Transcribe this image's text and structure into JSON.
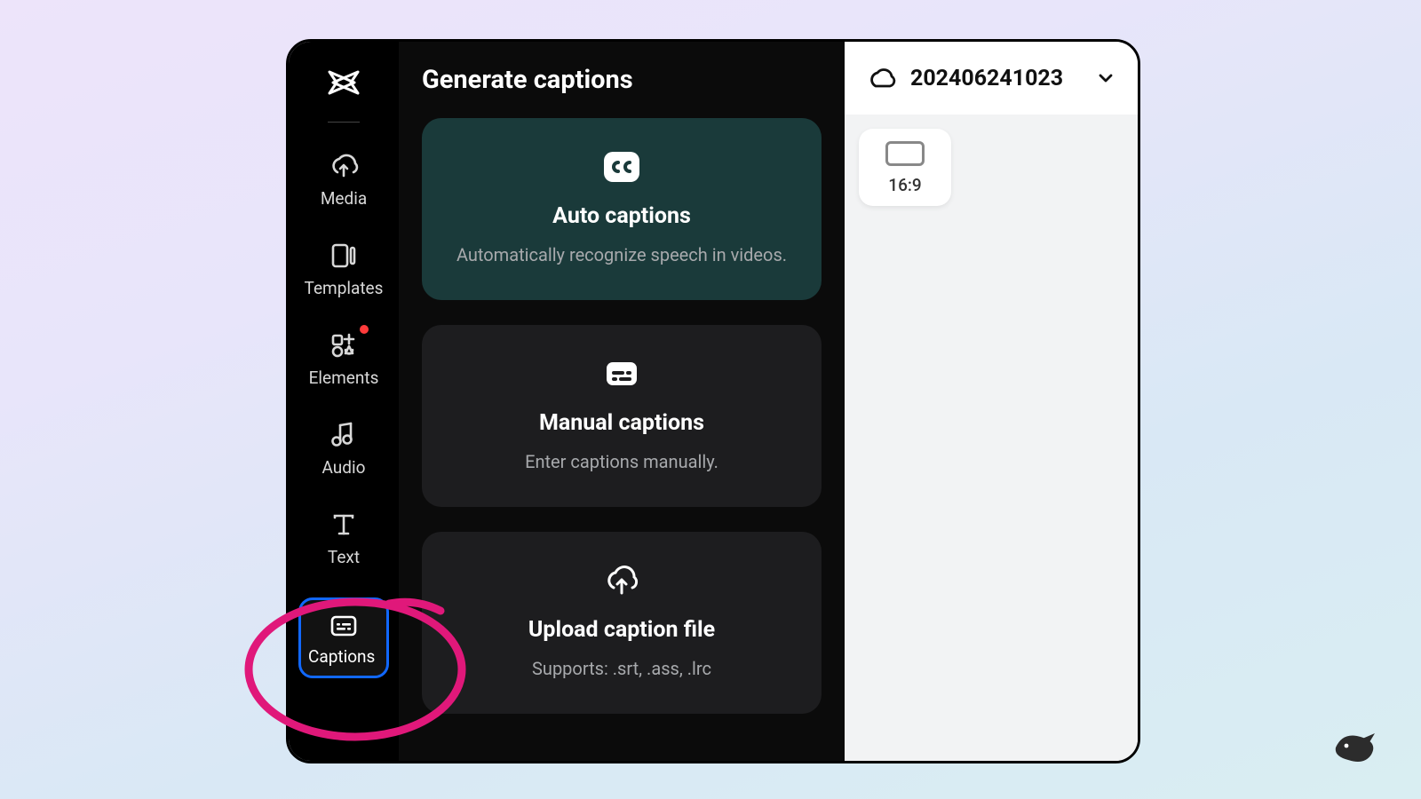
{
  "sidebar": {
    "items": [
      {
        "label": "Media"
      },
      {
        "label": "Templates"
      },
      {
        "label": "Elements"
      },
      {
        "label": "Audio"
      },
      {
        "label": "Text"
      },
      {
        "label": "Captions"
      }
    ]
  },
  "panel": {
    "title": "Generate captions",
    "cards": {
      "auto": {
        "title": "Auto captions",
        "desc": "Automatically recognize speech in videos."
      },
      "manual": {
        "title": "Manual captions",
        "desc": "Enter captions manually."
      },
      "upload": {
        "title": "Upload caption file",
        "desc": "Supports: .srt, .ass, .lrc"
      }
    }
  },
  "header": {
    "project_name": "202406241023"
  },
  "right": {
    "ratio_label": "16:9"
  }
}
